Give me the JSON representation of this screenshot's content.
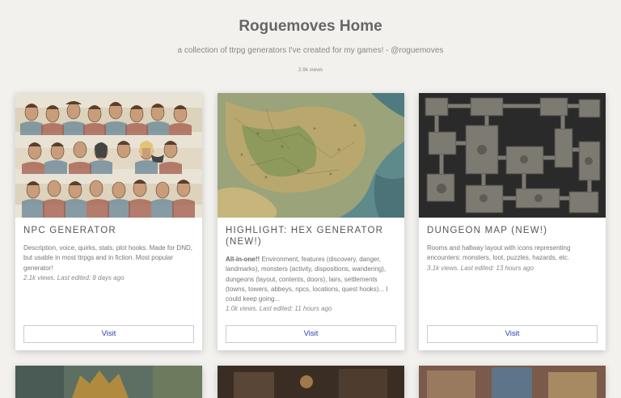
{
  "header": {
    "title": "Roguemoves Home",
    "subtitle": "a collection of ttrpg generators I've created for my games! - @roguemoves",
    "views": "2.9k views"
  },
  "cards": [
    {
      "title": "NPC GENERATOR",
      "description": "Description, voice, quirks, stats, plot hooks. Made for DND, but usable in most ttrpgs and in fiction. Most popular generator!",
      "meta": "2.1k views. Last edited: 8 days ago",
      "visit_label": "Visit"
    },
    {
      "title": "HIGHLIGHT: HEX GENERATOR (NEW!)",
      "description_bold": "All-in-one!!",
      "description": " Environment, features (discovery, danger, landmarks), monsters (activity, dispositions, wandering), dungeons (layout, contents, doors), lairs, settlements (towns, towers, abbeys, npcs, locations, quest hooks)... I could keep going...",
      "meta": "1.0k views. Last edited: 11 hours ago",
      "visit_label": "Visit"
    },
    {
      "title": "DUNGEON MAP (NEW!)",
      "description": "Rooms and hallway layout with icons representing encounters: monsters, loot, puzzles, hazards, etc.",
      "meta": "3.1k views. Last edited: 13 hours ago",
      "visit_label": "Visit"
    }
  ],
  "colors": {
    "background": "#f2f1ee",
    "link": "#2b3bb0"
  }
}
